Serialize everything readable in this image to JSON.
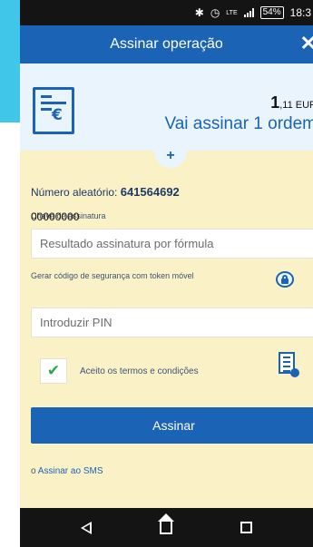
{
  "status_bar": {
    "battery": "54%",
    "network": "LTE",
    "time": "18:3"
  },
  "header": {
    "title": "Assinar operação",
    "close_icon": "close-icon"
  },
  "summary": {
    "amount_main": "1",
    "amount_decimal": ",11 EUR",
    "orders_text": "Vai assinar 1 ordem"
  },
  "form": {
    "random_label": "Número aleatório: ",
    "random_value": "641564692",
    "signature_key_label": "Chave de assinatura",
    "signature_field_value": "Resultado assinatura por fórmula",
    "token_label": "Gerar código de segurança com token móvel",
    "token_code": "00000000",
    "pin_placeholder": "Introduzir PIN",
    "terms_label": "Aceito os termos e condições",
    "terms_checked": true,
    "sign_button": "Assinar",
    "sms_prefix": "o ",
    "sms_link": "Assinar ao SMS"
  },
  "colors": {
    "primary": "#1b64b5",
    "background_form": "#fbf1c7",
    "summary_bg": "#eaf4fc",
    "accent_cyan": "#3fc6e8",
    "check_green": "#2aa84a"
  },
  "icons": [
    "bluetooth-icon",
    "alarm-icon",
    "signal-icon",
    "battery-icon",
    "document-euro-icon",
    "lock-icon",
    "checkmark-icon",
    "terms-document-icon",
    "back-nav-icon",
    "home-nav-icon",
    "recents-nav-icon"
  ]
}
